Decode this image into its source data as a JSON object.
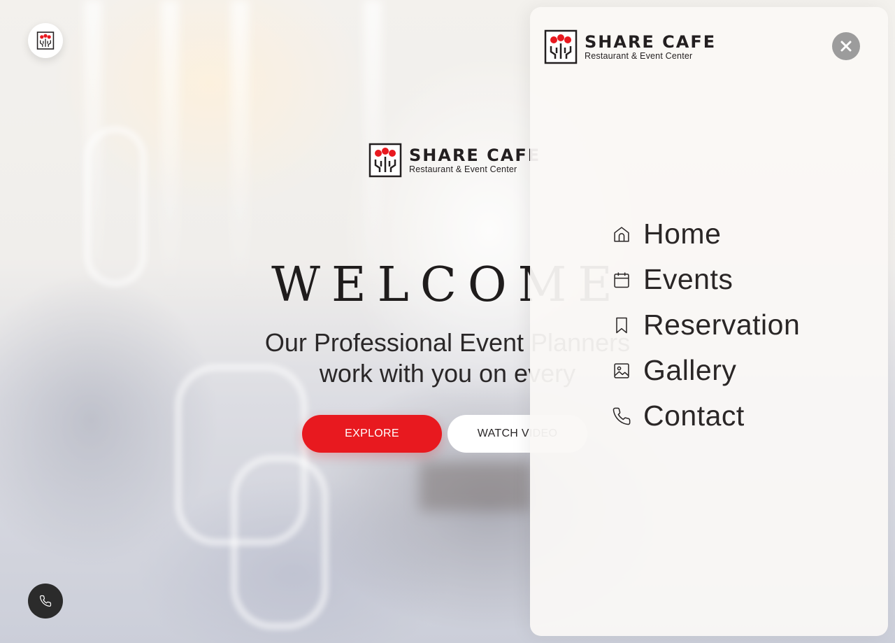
{
  "brand": {
    "name": "SHARE CAFE",
    "tagline": "Restaurant & Event Center"
  },
  "hero": {
    "title": "WELCOME",
    "subtitle_line1": "Our Professional Event Planners",
    "subtitle_line2": "work with you on every",
    "explore_label": "EXPLORE",
    "watch_video_label": "WATCH VIDEO"
  },
  "menu": {
    "items": [
      {
        "label": "Home",
        "icon": "home-icon"
      },
      {
        "label": "Events",
        "icon": "calendar-icon"
      },
      {
        "label": "Reservation",
        "icon": "bookmark-icon"
      },
      {
        "label": "Gallery",
        "icon": "image-icon"
      },
      {
        "label": "Contact",
        "icon": "phone-icon"
      }
    ]
  },
  "colors": {
    "accent_red": "#e8191f",
    "text_dark": "#2a2626",
    "close_button": "#9c9c9c",
    "fab": "#2b2b2b"
  }
}
